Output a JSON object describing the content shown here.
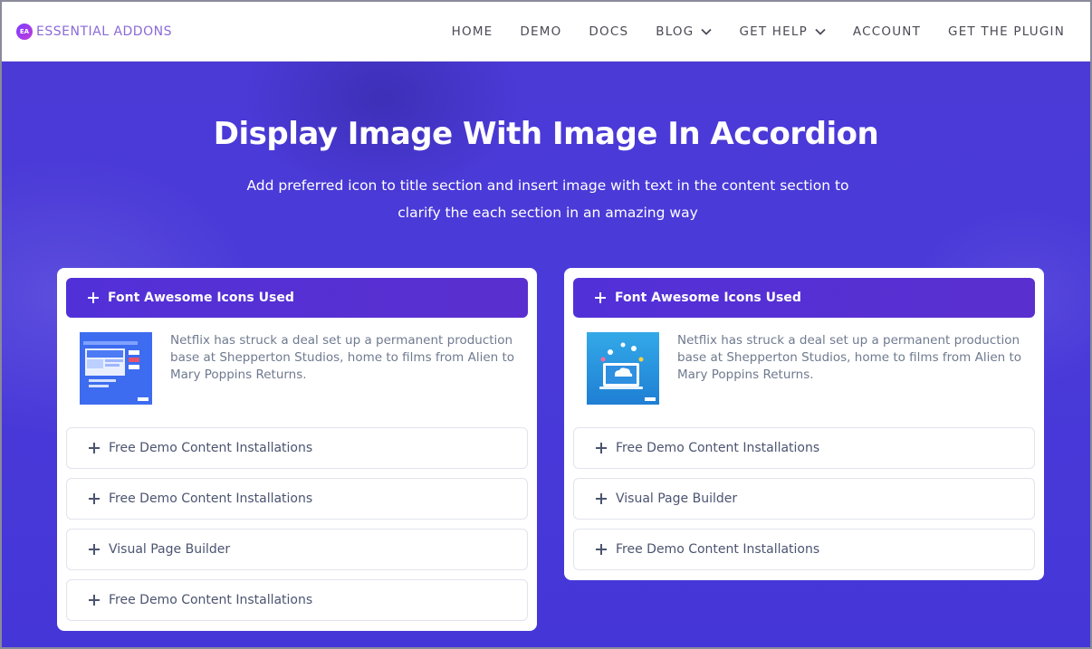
{
  "brand": {
    "badge": "EA",
    "name": "ESSENTIAL ADDONS"
  },
  "nav": [
    {
      "label": "HOME",
      "has_dropdown": false
    },
    {
      "label": "DEMO",
      "has_dropdown": false
    },
    {
      "label": "DOCS",
      "has_dropdown": false
    },
    {
      "label": "BLOG",
      "has_dropdown": true
    },
    {
      "label": "GET HELP",
      "has_dropdown": true
    },
    {
      "label": "ACCOUNT",
      "has_dropdown": false
    },
    {
      "label": "GET THE PLUGIN",
      "has_dropdown": false
    }
  ],
  "hero": {
    "title": "Display Image With Image In Accordion",
    "subtitle": "Add preferred icon to title section and insert image with text in the content section to clarify the each section in an amazing way"
  },
  "colors": {
    "hero_bg": "#4a3ad9",
    "accordion_active": "#5230d8",
    "logo": "#8b6ad8"
  },
  "accordions": {
    "left": {
      "active_title": "Font Awesome Icons Used",
      "content_text": "Netflix has struck a deal set up a permanent production base at Shepperton Studios, home to films from Alien to Mary Poppins Returns.",
      "items": [
        "Free Demo Content Installations",
        "Free Demo Content Installations",
        "Visual Page Builder",
        "Free Demo Content Installations"
      ]
    },
    "right": {
      "active_title": "Font Awesome Icons Used",
      "content_text": "Netflix has struck a deal set up a permanent production base at Shepperton Studios, home to films from Alien to Mary Poppins Returns.",
      "items": [
        "Free Demo Content Installations",
        "Visual Page Builder",
        "Free Demo Content Installations"
      ]
    }
  }
}
